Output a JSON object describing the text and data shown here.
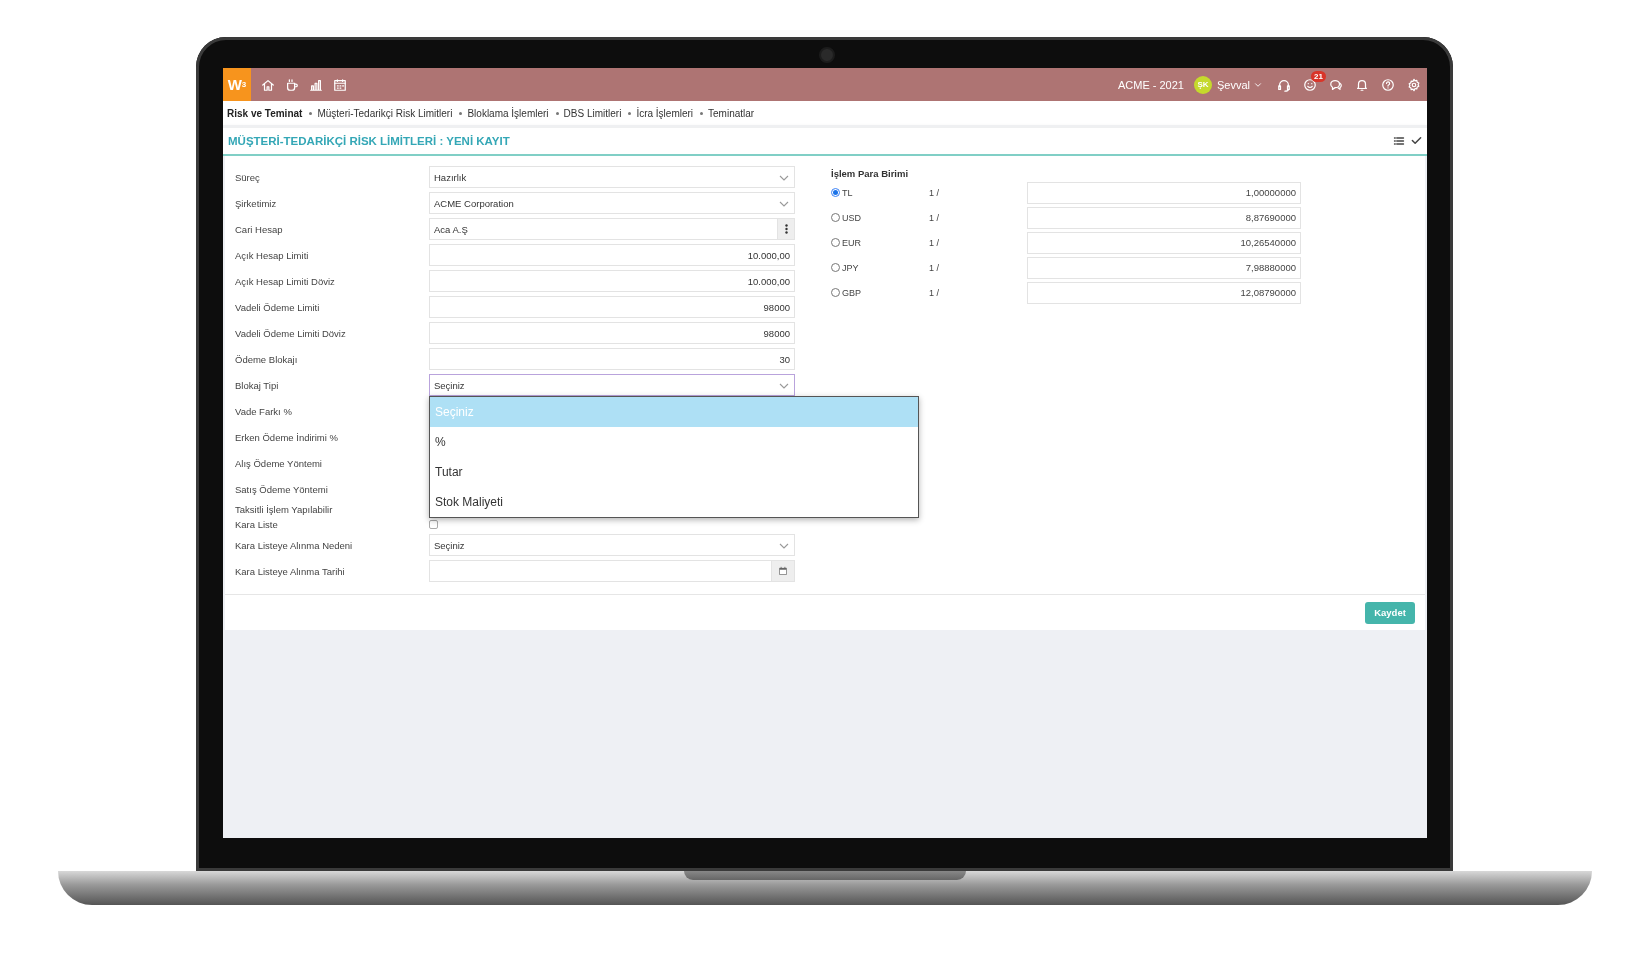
{
  "topbar": {
    "logo": "W",
    "logo_sup": "3",
    "company": "ACME - 2021",
    "user": {
      "initials": "ŞK",
      "name": "Şevval"
    },
    "notification_count": "21"
  },
  "breadcrumb": {
    "root": "Risk ve Teminat",
    "items": [
      "Müşteri-Tedarikçi Risk Limitleri",
      "Bloklama İşlemleri",
      "DBS Limitleri",
      "İcra İşlemleri",
      "Teminatlar"
    ]
  },
  "page_title": "MÜŞTERİ-TEDARİKÇİ RİSK LİMİTLERİ : YENİ KAYIT",
  "form_fields": [
    {
      "label": "Süreç",
      "kind": "select",
      "value": "Hazırlık",
      "open": false
    },
    {
      "label": "Şirketimiz",
      "kind": "select",
      "value": "ACME Corporation",
      "open": false
    },
    {
      "label": "Cari Hesap",
      "kind": "lookup",
      "value": "Aca A.Ş"
    },
    {
      "label": "Açık Hesap Limiti",
      "kind": "number",
      "value": "10.000,00"
    },
    {
      "label": "Açık Hesap Limiti Döviz",
      "kind": "number",
      "value": "10.000,00"
    },
    {
      "label": "Vadeli Ödeme Limiti",
      "kind": "number",
      "value": "98000"
    },
    {
      "label": "Vadeli Ödeme Limiti Döviz",
      "kind": "number",
      "value": "98000"
    },
    {
      "label": "Ödeme Blokajı",
      "kind": "number",
      "value": "30"
    },
    {
      "label": "Blokaj Tipi",
      "kind": "select",
      "value": "Seçiniz",
      "open": true,
      "options": [
        {
          "label": "Seçiniz",
          "selected": true
        },
        {
          "label": "%",
          "selected": false
        },
        {
          "label": "Tutar",
          "selected": false
        },
        {
          "label": "Stok Maliyeti",
          "selected": false
        }
      ]
    },
    {
      "label": "Vade Farkı %",
      "kind": "covered"
    },
    {
      "label": "Erken Ödeme İndirimi %",
      "kind": "covered"
    },
    {
      "label": "Alış Ödeme Yöntemi",
      "kind": "covered"
    },
    {
      "label": "Satış Ödeme Yöntemi",
      "kind": "covered"
    },
    {
      "label": "Taksitli İşlem Yapılabilir",
      "kind": "caption"
    },
    {
      "label": "Kara Liste",
      "kind": "checkbox",
      "checked": false
    },
    {
      "label": "Kara Listeye Alınma Nedeni",
      "kind": "select",
      "value": "Seçiniz",
      "open": false
    },
    {
      "label": "Kara Listeye Alınma Tarihi",
      "kind": "date"
    }
  ],
  "currency": {
    "title": "İşlem Para Birimi",
    "rows": [
      {
        "code": "TL",
        "ratio": "1 /",
        "rate": "1,00000000",
        "selected": true
      },
      {
        "code": "USD",
        "ratio": "1 /",
        "rate": "8,87690000",
        "selected": false
      },
      {
        "code": "EUR",
        "ratio": "1 /",
        "rate": "10,26540000",
        "selected": false
      },
      {
        "code": "JPY",
        "ratio": "1 /",
        "rate": "7,98880000",
        "selected": false
      },
      {
        "code": "GBP",
        "ratio": "1 /",
        "rate": "12,08790000",
        "selected": false
      }
    ]
  },
  "save_button": "Kaydet"
}
